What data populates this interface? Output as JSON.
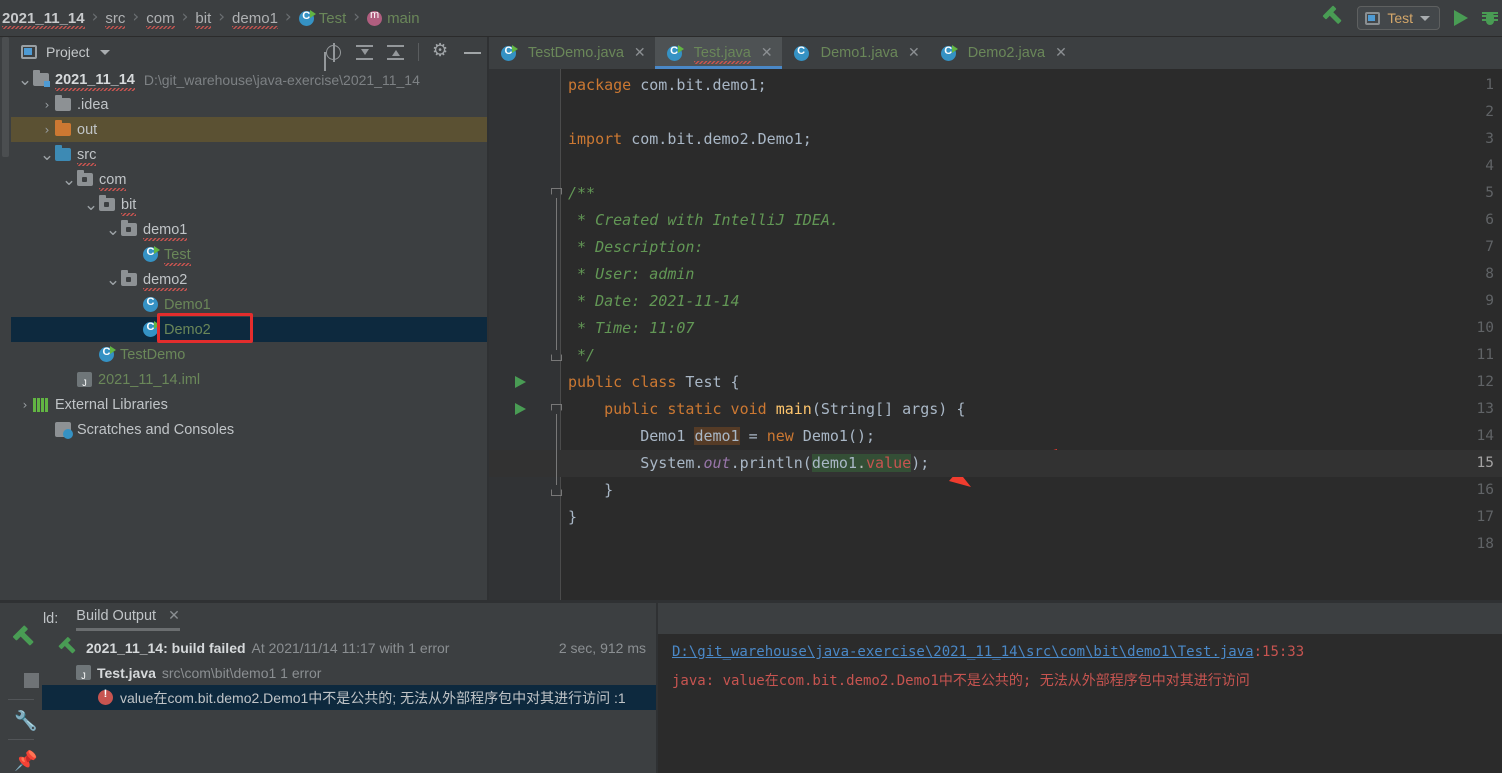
{
  "breadcrumb": [
    {
      "label": "2021_11_14",
      "kind": "bold-squiggle"
    },
    {
      "label": "src",
      "kind": "squiggle"
    },
    {
      "label": "com",
      "kind": "squiggle"
    },
    {
      "label": "bit",
      "kind": "squiggle"
    },
    {
      "label": "demo1",
      "kind": "squiggle"
    },
    {
      "label": "Test",
      "kind": "class-green"
    },
    {
      "label": "main",
      "kind": "method-green"
    }
  ],
  "toolbar": {
    "build_icon": "hammer-icon",
    "run_config_name": "Test",
    "run_icon": "run-play-icon",
    "debug_icon": "debug-bug-icon"
  },
  "project": {
    "title": "Project",
    "actions": [
      "select-opened-file-icon",
      "collapse-all-icon",
      "expand-all-icon",
      "settings-gear-icon",
      "hide-icon"
    ],
    "tree": [
      {
        "label": "2021_11_14",
        "path": "D:\\git_warehouse\\java-exercise\\2021_11_14",
        "indent": 0,
        "arrow": "v",
        "icon": "module-folder",
        "style": "bold-squiggle"
      },
      {
        "label": ".idea",
        "indent": 1,
        "arrow": ">",
        "icon": "folder-gray",
        "style": "plain"
      },
      {
        "label": "out",
        "indent": 1,
        "arrow": ">",
        "icon": "folder-orange",
        "style": "plain",
        "selected": "out"
      },
      {
        "label": "src",
        "indent": 1,
        "arrow": "v",
        "icon": "folder-blue",
        "style": "squiggle"
      },
      {
        "label": "com",
        "indent": 2,
        "arrow": "v",
        "icon": "folder-package",
        "style": "squiggle"
      },
      {
        "label": "bit",
        "indent": 3,
        "arrow": "v",
        "icon": "folder-package",
        "style": "squiggle"
      },
      {
        "label": "demo1",
        "indent": 4,
        "arrow": "v",
        "icon": "folder-package",
        "style": "squiggle"
      },
      {
        "label": "Test",
        "indent": 5,
        "arrow": "",
        "icon": "class-runnable",
        "style": "green-squiggle",
        "boxed": true
      },
      {
        "label": "demo2",
        "indent": 4,
        "arrow": "v",
        "icon": "folder-package",
        "style": "squiggle"
      },
      {
        "label": "Demo1",
        "indent": 5,
        "arrow": "",
        "icon": "class",
        "style": "green"
      },
      {
        "label": "Demo2",
        "indent": 5,
        "arrow": "",
        "icon": "class-runnable",
        "style": "green",
        "selected": "blue"
      },
      {
        "label": "TestDemo",
        "indent": 3,
        "arrow": "",
        "icon": "class-runnable",
        "style": "green"
      },
      {
        "label": "2021_11_14.iml",
        "indent": 2,
        "arrow": "",
        "icon": "iml-file",
        "style": "green"
      },
      {
        "label": "External Libraries",
        "indent": 0,
        "arrow": ">",
        "icon": "libraries-icon",
        "style": "plain"
      },
      {
        "label": "Scratches and Consoles",
        "indent": 1,
        "arrow": "",
        "icon": "scratches-icon",
        "style": "plain"
      }
    ]
  },
  "editor": {
    "tabs": [
      {
        "label": "TestDemo.java",
        "icon": "class-runnable",
        "active": false
      },
      {
        "label": "Test.java",
        "icon": "class-runnable",
        "active": true
      },
      {
        "label": "Demo1.java",
        "icon": "class",
        "active": false
      },
      {
        "label": "Demo2.java",
        "icon": "class-runnable",
        "active": false
      }
    ],
    "current_line": 15,
    "lines": [
      {
        "n": 1,
        "text": "package com.bit.demo1;"
      },
      {
        "n": 2,
        "text": ""
      },
      {
        "n": 3,
        "text": "import com.bit.demo2.Demo1;"
      },
      {
        "n": 4,
        "text": ""
      },
      {
        "n": 5,
        "text": "/**"
      },
      {
        "n": 6,
        "text": " * Created with IntelliJ IDEA."
      },
      {
        "n": 7,
        "text": " * Description:"
      },
      {
        "n": 8,
        "text": " * User: admin"
      },
      {
        "n": 9,
        "text": " * Date: 2021-11-14"
      },
      {
        "n": 10,
        "text": " * Time: 11:07"
      },
      {
        "n": 11,
        "text": " */"
      },
      {
        "n": 12,
        "text": "public class Test {",
        "gutter_run": true
      },
      {
        "n": 13,
        "text": "    public static void main(String[] args) {",
        "gutter_run": true
      },
      {
        "n": 14,
        "text": "        Demo1 demo1 = new Demo1();"
      },
      {
        "n": 15,
        "text": "        System.out.println(demo1.value);"
      },
      {
        "n": 16,
        "text": "    }"
      },
      {
        "n": 17,
        "text": "}"
      },
      {
        "n": 18,
        "text": ""
      }
    ],
    "annotation": "red-arrow-pointing-to-line-14"
  },
  "build": {
    "panel_label": "Build:",
    "tab_label": "Build Output",
    "rows": [
      {
        "title": "2021_11_14: build failed",
        "detail": "At 2021/11/14 11:17 with 1 error",
        "time": "2 sec, 912 ms",
        "icon": "build-hammer-icon"
      },
      {
        "title": "Test.java",
        "detail": "src\\com\\bit\\demo1 1 error",
        "icon": "java-file-icon"
      },
      {
        "title": "value在com.bit.demo2.Demo1中不是公共的; 无法从外部程序包中对其进行访问 :1",
        "icon": "error-icon",
        "selected": true
      }
    ],
    "message": {
      "file_link": "D:\\git_warehouse\\java-exercise\\2021_11_14\\src\\com\\bit\\demo1\\Test.java",
      "location": ":15:33",
      "error": "java: value在com.bit.demo2.Demo1中不是公共的; 无法从外部程序包中对其进行访问"
    },
    "side_icons": [
      "build-hammer-icon",
      "stop-icon",
      "wrench-settings-icon",
      "pin-icon"
    ]
  },
  "colors": {
    "accent_blue": "#4a88c7",
    "error_red": "#c75450",
    "green_string": "#6a8759",
    "keyword_orange": "#cc7832",
    "selection_blue": "#0d293e",
    "highlight_box": "#e32d2d"
  }
}
